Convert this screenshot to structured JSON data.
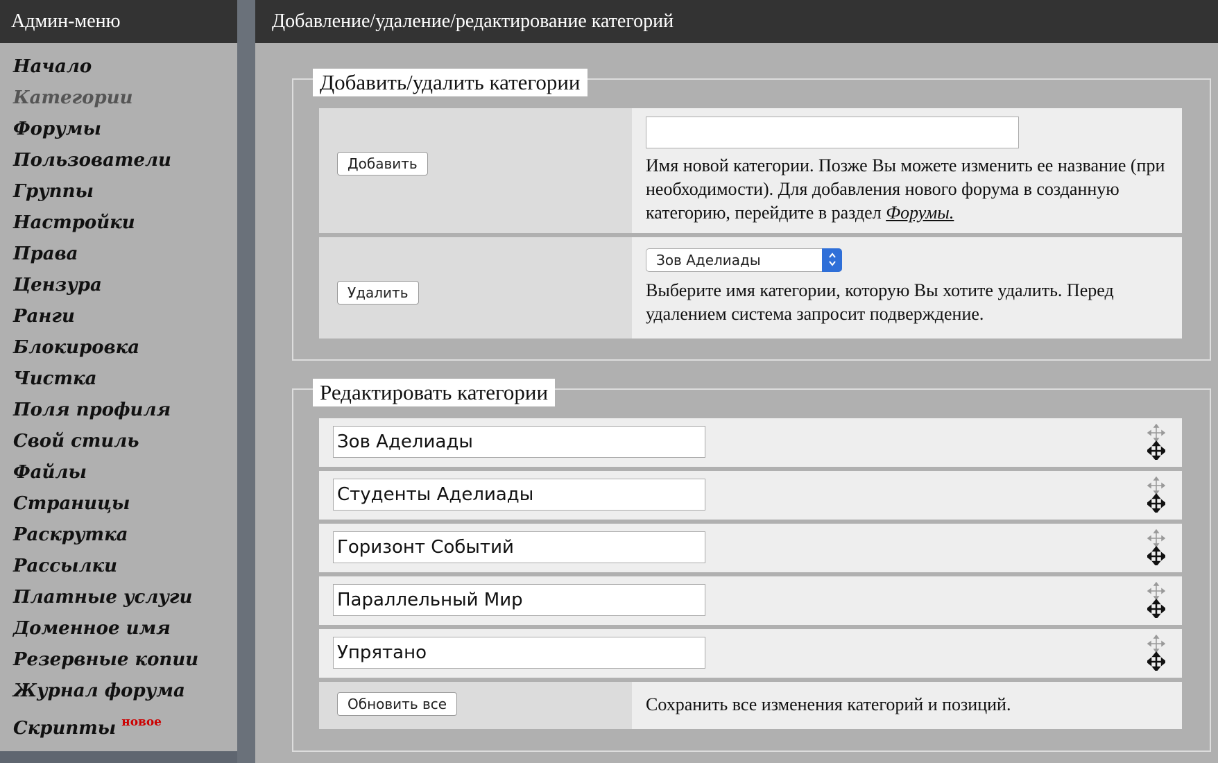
{
  "sidebar": {
    "title": "Админ-меню",
    "items": [
      {
        "label": "Начало"
      },
      {
        "label": "Категории"
      },
      {
        "label": "Форумы"
      },
      {
        "label": "Пользователи"
      },
      {
        "label": "Группы"
      },
      {
        "label": "Настройки"
      },
      {
        "label": "Права"
      },
      {
        "label": "Цензура"
      },
      {
        "label": "Ранги"
      },
      {
        "label": "Блокировка"
      },
      {
        "label": "Чистка"
      },
      {
        "label": "Поля профиля"
      },
      {
        "label": "Свой стиль"
      },
      {
        "label": "Файлы"
      },
      {
        "label": "Страницы"
      },
      {
        "label": "Раскрутка"
      },
      {
        "label": "Рассылки"
      },
      {
        "label": "Платные услуги"
      },
      {
        "label": "Доменное имя"
      },
      {
        "label": "Резервные копии"
      },
      {
        "label": "Журнал форума"
      },
      {
        "label": "Скрипты",
        "badge": "новое"
      }
    ],
    "active_index": 1
  },
  "main": {
    "title": "Добавление/удаление/редактирование категорий",
    "add_remove": {
      "legend": "Добавить/удалить категории",
      "add_button": "Добавить",
      "new_name_value": "",
      "add_desc": "Имя новой категории. Позже Вы можете изменить ее название (при необходимости). Для добавления нового форума в созданную категорию, перейдите в раздел ",
      "add_desc_link": "Форумы.",
      "delete_button": "Удалить",
      "delete_select_value": "Зов Аделиады",
      "delete_desc": "Выберите имя категории, которую Вы хотите удалить. Перед удалением система запросит подверждение."
    },
    "edit": {
      "legend": "Редактировать категории",
      "categories": [
        {
          "name": "Зов Аделиады"
        },
        {
          "name": "Студенты Аделиады"
        },
        {
          "name": "Горизонт Событий"
        },
        {
          "name": "Параллельный Мир"
        },
        {
          "name": "Упрятано"
        }
      ],
      "update_button": "Обновить все",
      "update_desc": "Сохранить все изменения категорий и позиций."
    }
  },
  "icons": {
    "drag": "move-arrows-icon",
    "select_arrow": "chevron-updown-icon"
  },
  "colors": {
    "header_bg": "#333333",
    "panel_bg": "#b0b0b0",
    "badge": "#cc0000",
    "select_arrow": "#2f6fd8"
  }
}
